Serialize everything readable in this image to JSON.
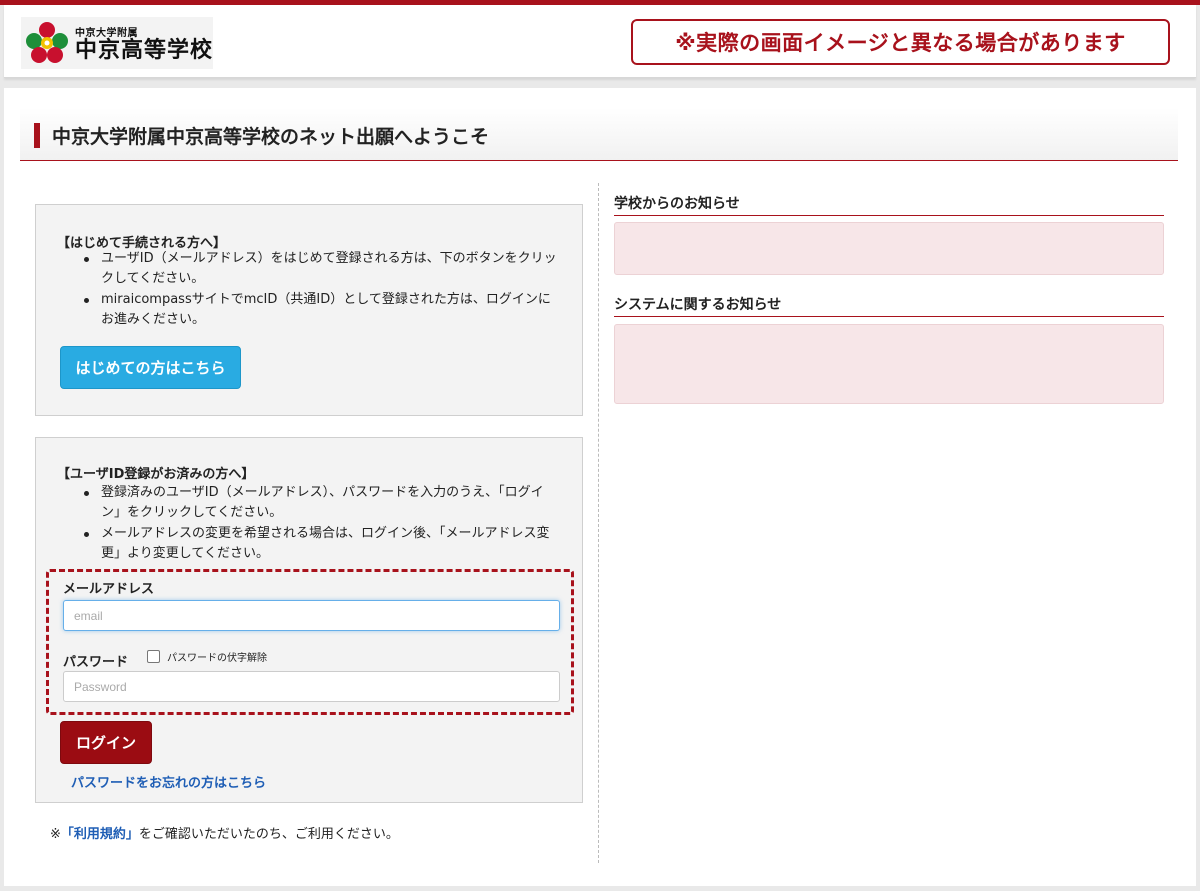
{
  "header": {
    "logo_small": "中京大学附属",
    "logo_big": "中京高等学校",
    "notice": "※実際の画面イメージと異なる場合があります"
  },
  "page": {
    "title": "中京大学附属中京高等学校のネット出願へようこそ"
  },
  "first_time": {
    "heading": "【はじめて手続される方へ】",
    "bullets": [
      "ユーザID（メールアドレス）をはじめて登録される方は、下のボタンをクリックしてください。",
      "miraicompassサイトでmcID（共通ID）として登録された方は、ログインにお進みください。"
    ],
    "button_label": "はじめての方はこちら"
  },
  "registered": {
    "heading": "【ユーザID登録がお済みの方へ】",
    "bullets": [
      "登録済みのユーザID（メールアドレス）、パスワードを入力のうえ、「ログイン」をクリックしてください。",
      "メールアドレスの変更を希望される場合は、ログイン後、「メールアドレス変更」より変更してください。"
    ],
    "email_label": "メールアドレス",
    "email_placeholder": "email",
    "password_label": "パスワード",
    "show_password_label": "パスワードの伏字解除",
    "password_placeholder": "Password",
    "login_button": "ログイン",
    "forgot_link": "パスワードをお忘れの方はこちら"
  },
  "terms": {
    "prefix": "※",
    "link": "「利用規約」",
    "suffix": "をご確認いただいたのち、ご利用ください。"
  },
  "news": {
    "school_heading": "学校からのお知らせ",
    "system_heading": "システムに関するお知らせ"
  },
  "colors": {
    "brand_red": "#a8121c",
    "first_button": "#29abe2",
    "login_button": "#9b0c12",
    "link_blue": "#1f5eb5",
    "news_bg": "#f7e6e8"
  }
}
